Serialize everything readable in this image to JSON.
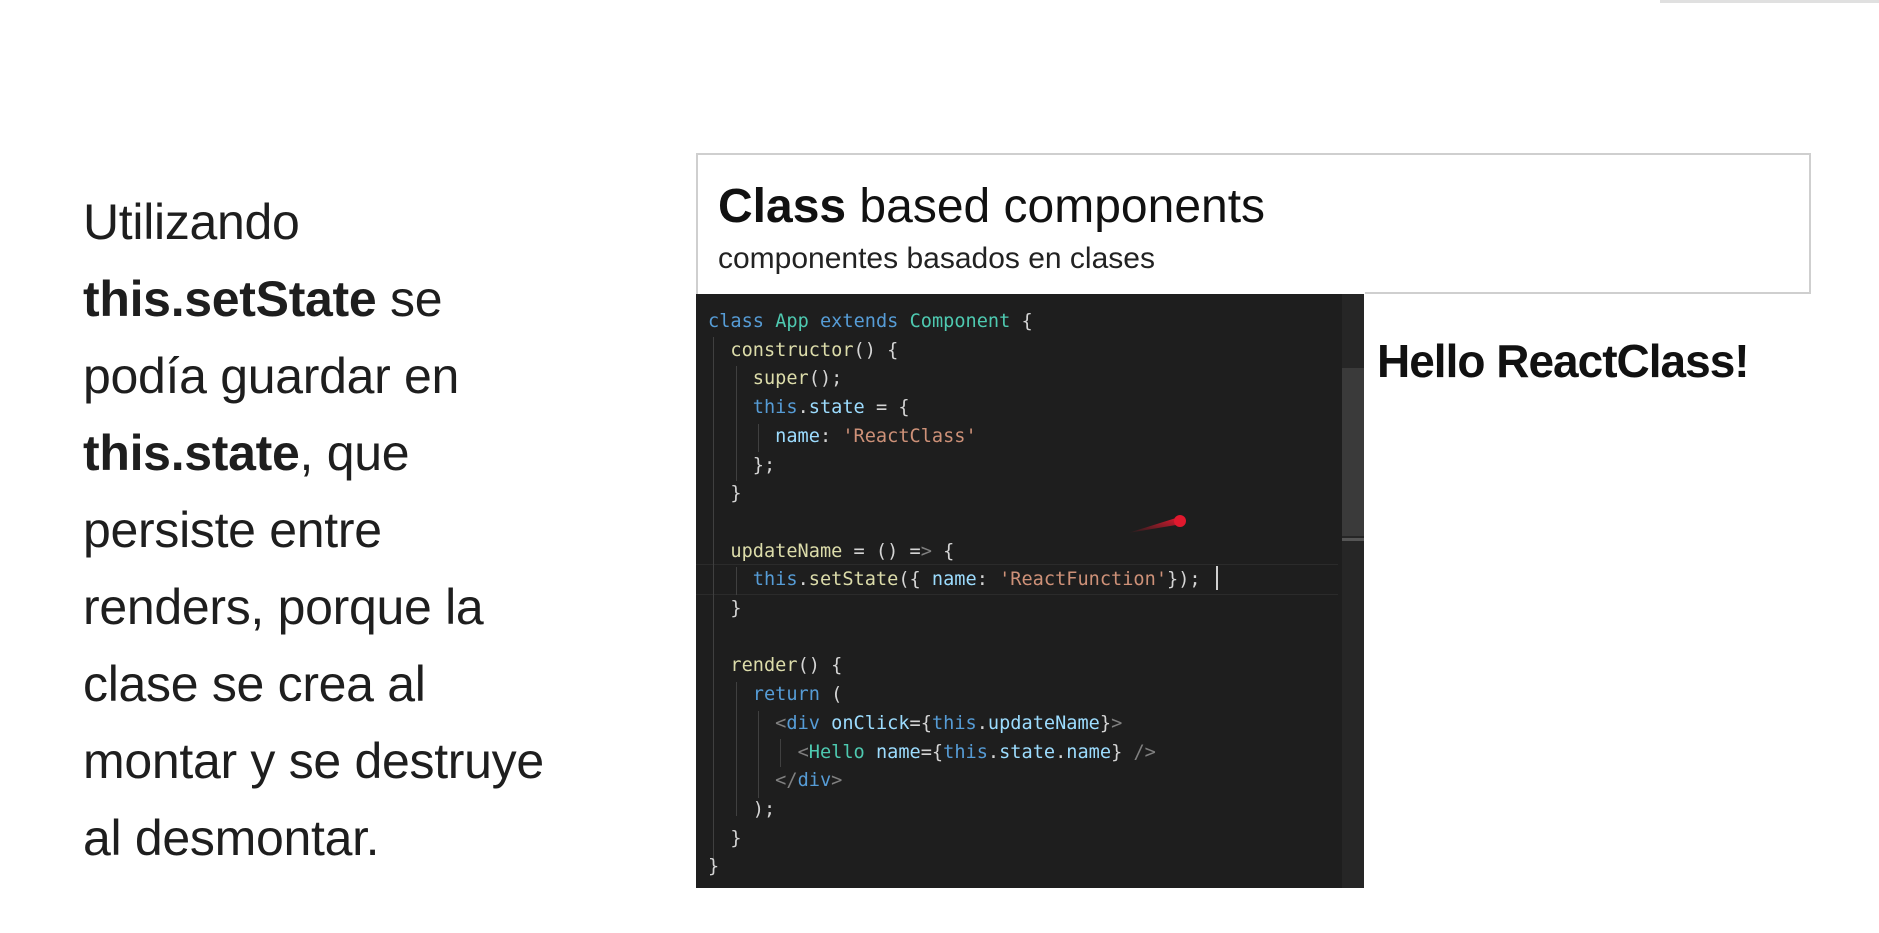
{
  "explanation": {
    "line1": "Utilizando",
    "bold1": "this.setState",
    "line2_rest": " se",
    "line3": "podía guardar en",
    "bold2": "this.state",
    "line4_rest": ", que",
    "line5": "persiste entre",
    "line6": "renders, porque la",
    "line7": "clase se crea al",
    "line8": "montar y se destruye",
    "line9": "al desmontar."
  },
  "slide": {
    "title_bold": "Class",
    "title_rest": " based components",
    "subtitle": "componentes basados en clases"
  },
  "output": {
    "text": "Hello ReactClass!"
  },
  "colors": {
    "editor_bg": "#1e1e1e",
    "keyword": "#569cd6",
    "function": "#dcdcaa",
    "class": "#4ec9b0",
    "string": "#ce9178",
    "property": "#9cdcfe",
    "pointer": "#e0192e"
  },
  "code_lines": [
    "class App extends Component {",
    "  constructor() {",
    "    super();",
    "    this.state = {",
    "      name: 'ReactClass'",
    "    };",
    "  }",
    "",
    "  updateName = () => {",
    "    this.setState({ name: 'ReactFunction'});",
    "  }",
    "",
    "  render() {",
    "    return (",
    "      <div onClick={this.updateName}>",
    "        <Hello name={this.state.name} />",
    "      </div>",
    "    );",
    "  }",
    "}"
  ]
}
